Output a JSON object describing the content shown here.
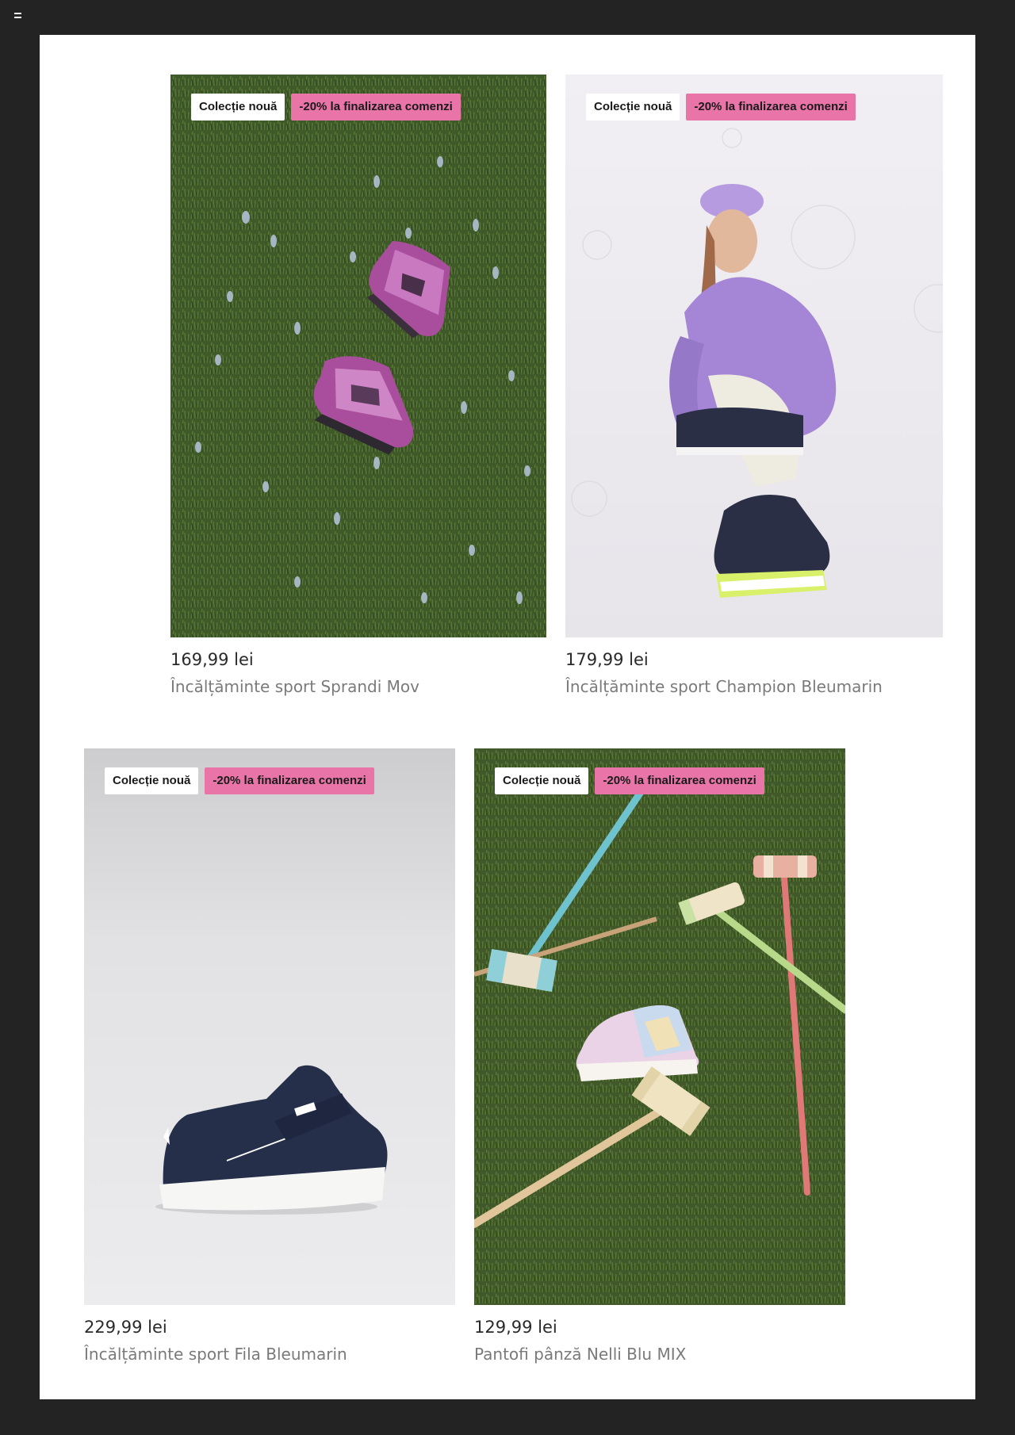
{
  "products": [
    {
      "badge_new": "Colecție nouă",
      "badge_promo": "-20% la finalizarea comenzi",
      "price": "169,99 lei",
      "name": "Încălțăminte sport Sprandi Mov"
    },
    {
      "badge_new": "Colecție nouă",
      "badge_promo": "-20% la finalizarea comenzi",
      "price": "179,99 lei",
      "name": "Încălțăminte sport Champion Bleumarin"
    },
    {
      "badge_new": "Colecție nouă",
      "badge_promo": "-20% la finalizarea comenzi",
      "price": "229,99 lei",
      "name": "Încălțăminte sport Fila Bleumarin"
    },
    {
      "badge_new": "Colecție nouă",
      "badge_promo": "-20% la finalizarea comenzi",
      "price": "129,99 lei",
      "name": "Pantofi pânză Nelli Blu MIX"
    }
  ],
  "colors": {
    "background": "#232323",
    "page": "#ffffff",
    "promo_badge": "#e874a8",
    "price_text": "#2a2a2a",
    "name_text": "#7a7a7a"
  },
  "icons": {
    "menu": "hamburger-menu-icon"
  }
}
